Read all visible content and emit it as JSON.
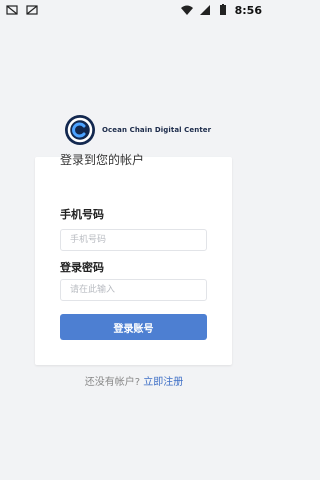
{
  "status_bar": {
    "time": "8:56"
  },
  "brand": {
    "name": "Ocean Chain Digital Center"
  },
  "login_card": {
    "title": "登录到您的帐户",
    "phone_label": "手机号码",
    "phone_placeholder": "手机号码",
    "password_label": "登录密码",
    "password_placeholder": "请在此输入",
    "submit_label": "登录账号"
  },
  "register": {
    "prompt": "还没有帐户?",
    "link_label": "立即注册"
  },
  "colors": {
    "accent": "#4d7fd2",
    "link": "#3e6fc6",
    "background": "#f2f3f5"
  }
}
